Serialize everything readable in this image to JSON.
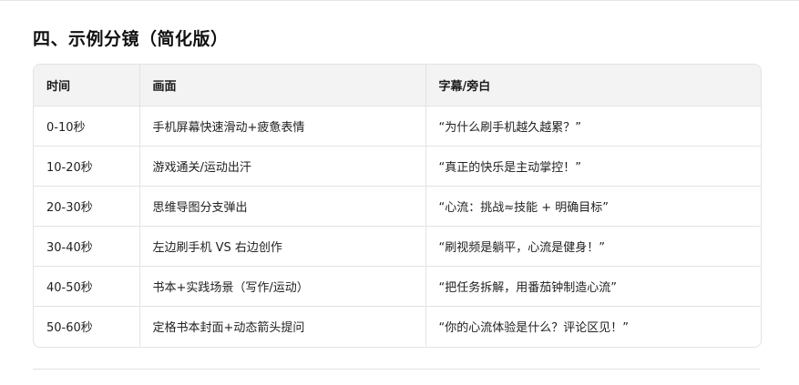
{
  "section": {
    "title": "四、示例分镜（简化版）"
  },
  "table": {
    "headers": [
      "时间",
      "画面",
      "字幕/旁白"
    ],
    "rows": [
      [
        "0-10秒",
        "手机屏幕快速滑动+疲惫表情",
        "“为什么刷手机越久越累？”"
      ],
      [
        "10-20秒",
        "游戏通关/运动出汗",
        "“真正的快乐是主动掌控！”"
      ],
      [
        "20-30秒",
        "思维导图分支弹出",
        "“心流：挑战≈技能 + 明确目标”"
      ],
      [
        "30-40秒",
        "左边刷手机 VS 右边创作",
        "“刷视频是躺平，心流是健身！”"
      ],
      [
        "40-50秒",
        "书本+实践场景（写作/运动）",
        "“把任务拆解，用番茄钟制造心流”"
      ],
      [
        "50-60秒",
        "定格书本封面+动态箭头提问",
        "“你的心流体验是什么？评论区见！”"
      ]
    ]
  }
}
